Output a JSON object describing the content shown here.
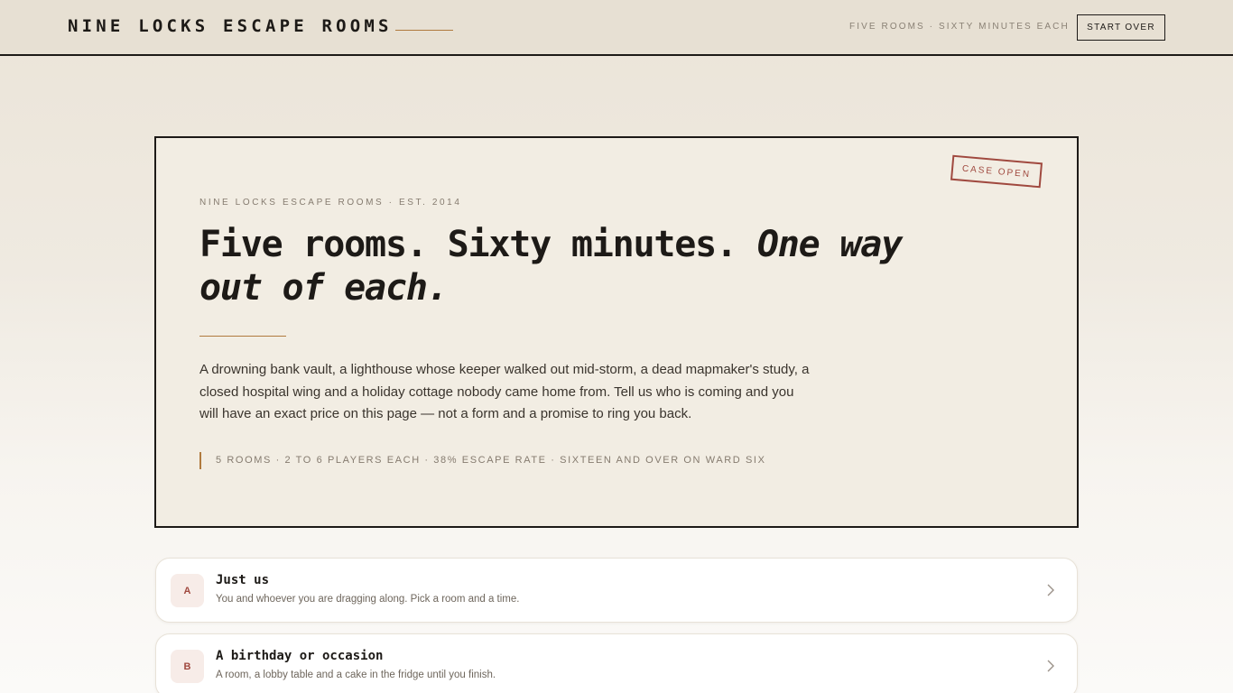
{
  "header": {
    "brand": "NINE LOCKS ESCAPE ROOMS",
    "tagline": "FIVE ROOMS · SIXTY MINUTES EACH",
    "start_over_label": "START OVER"
  },
  "hero": {
    "stamp": "CASE OPEN",
    "eyebrow": "NINE LOCKS ESCAPE ROOMS · EST. 2014",
    "headline_plain": "Five rooms. Sixty minutes. ",
    "headline_em": "One way out of each.",
    "lede": "A drowning bank vault, a lighthouse whose keeper walked out mid-storm, a dead mapmaker's study, a closed hospital wing and a holiday cottage nobody came home from. Tell us who is coming and you will have an exact price on this page — not a form and a promise to ring you back.",
    "stats": "5 ROOMS · 2 TO 6 PLAYERS EACH · 38% ESCAPE RATE · SIXTEEN AND OVER ON WARD SIX"
  },
  "options": [
    {
      "badge": "A",
      "title": "Just us",
      "description": "You and whoever you are dragging along. Pick a room and a time."
    },
    {
      "badge": "B",
      "title": "A birthday or occasion",
      "description": "A room, a lobby table and a cake in the fridge until you finish."
    }
  ],
  "colors": {
    "ink": "#1d1a17",
    "accent_rust": "#a0493f",
    "accent_brass": "#b07a3e",
    "paper": "#f2ede3"
  },
  "icons": {
    "option_arrow": "chevron-right-icon"
  }
}
